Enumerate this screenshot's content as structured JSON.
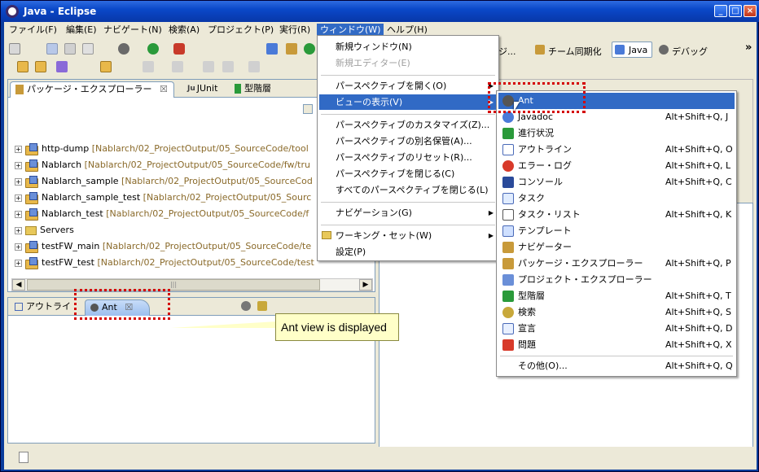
{
  "window": {
    "title": "Java - Eclipse"
  },
  "menubar": [
    {
      "label": "ファイル(F)"
    },
    {
      "label": "編集(E)"
    },
    {
      "label": "ナビゲート(N)"
    },
    {
      "label": "検索(A)"
    },
    {
      "label": "プロジェクト(P)"
    },
    {
      "label": "実行(R)"
    },
    {
      "label": "ウィンドウ(W)"
    },
    {
      "label": "ヘルプ(H)"
    }
  ],
  "perspective_bar": {
    "partial_label": "ポジ...",
    "team_sync": "チーム同期化",
    "java": "Java",
    "debug": "デバッグ",
    "overflow": "»"
  },
  "explorer": {
    "tabs": [
      "パッケージ・エクスプローラー",
      "JUnit",
      "型階層"
    ],
    "tab_close": "☒",
    "rows": [
      {
        "name": "http-dump",
        "path": "[Nablarch/02_ProjectOutput/05_SourceCode/tool"
      },
      {
        "name": "Nablarch",
        "path": "[Nablarch/02_ProjectOutput/05_SourceCode/fw/tru"
      },
      {
        "name": "Nablarch_sample",
        "path": "[Nablarch/02_ProjectOutput/05_SourceCod"
      },
      {
        "name": "Nablarch_sample_test",
        "path": "[Nablarch/02_ProjectOutput/05_Sourc"
      },
      {
        "name": "Nablarch_test",
        "path": "[Nablarch/02_ProjectOutput/05_SourceCode/f"
      },
      {
        "name": "Servers",
        "path": ""
      },
      {
        "name": "testFW_main",
        "path": "[Nablarch/02_ProjectOutput/05_SourceCode/te"
      },
      {
        "name": "testFW_test",
        "path": "[Nablarch/02_ProjectOutput/05_SourceCode/test"
      }
    ],
    "expander": "+",
    "scroll_grip": "|||"
  },
  "bottom_panel": {
    "tabs": [
      "アウトライ",
      "Ant"
    ]
  },
  "window_menu": {
    "items": [
      {
        "label": "新規ウィンドウ(N)",
        "disabled": false
      },
      {
        "label": "新規エディター(E)",
        "disabled": true
      },
      {
        "label": "パースペクティブを開く(O)",
        "submenu": true
      },
      {
        "label": "ビューの表示(V)",
        "submenu": true,
        "highlighted": true
      },
      {
        "label": "パースペクティブのカスタマイズ(Z)..."
      },
      {
        "label": "パースペクティブの別名保管(A)..."
      },
      {
        "label": "パースペクティブのリセット(R)..."
      },
      {
        "label": "パースペクティブを閉じる(C)"
      },
      {
        "label": "すべてのパースペクティブを閉じる(L)"
      },
      {
        "label": "ナビゲーション(G)",
        "submenu": true
      },
      {
        "label": "ワーキング・セット(W)",
        "submenu": true
      },
      {
        "label": "設定(P)"
      }
    ],
    "arrow": "▶"
  },
  "show_view_menu": {
    "items": [
      {
        "label": "Ant",
        "shortcut": "",
        "icon": "ant-icon",
        "highlighted": true
      },
      {
        "label": "Javadoc",
        "shortcut": "Alt+Shift+Q, J",
        "icon": "javadoc-icon"
      },
      {
        "label": "進行状況",
        "shortcut": "",
        "icon": "progress-icon"
      },
      {
        "label": "アウトライン",
        "shortcut": "Alt+Shift+Q, O",
        "icon": "outline-icon"
      },
      {
        "label": "エラー・ログ",
        "shortcut": "Alt+Shift+Q, L",
        "icon": "error-log-icon"
      },
      {
        "label": "コンソール",
        "shortcut": "Alt+Shift+Q, C",
        "icon": "console-icon"
      },
      {
        "label": "タスク",
        "shortcut": "",
        "icon": "task-icon"
      },
      {
        "label": "タスク・リスト",
        "shortcut": "Alt+Shift+Q, K",
        "icon": "task-list-icon"
      },
      {
        "label": "テンプレート",
        "shortcut": "",
        "icon": "template-icon"
      },
      {
        "label": "ナビゲーター",
        "shortcut": "",
        "icon": "navigator-icon"
      },
      {
        "label": "パッケージ・エクスプローラー",
        "shortcut": "Alt+Shift+Q, P",
        "icon": "package-explorer-icon"
      },
      {
        "label": "プロジェクト・エクスプローラー",
        "shortcut": "",
        "icon": "project-explorer-icon"
      },
      {
        "label": "型階層",
        "shortcut": "Alt+Shift+Q, T",
        "icon": "type-hierarchy-icon"
      },
      {
        "label": "検索",
        "shortcut": "Alt+Shift+Q, S",
        "icon": "search-icon"
      },
      {
        "label": "宣言",
        "shortcut": "Alt+Shift+Q, D",
        "icon": "declaration-icon"
      },
      {
        "label": "問題",
        "shortcut": "Alt+Shift+Q, X",
        "icon": "problems-icon"
      },
      {
        "label": "その他(O)...",
        "shortcut": "Alt+Shift+Q, Q",
        "icon": ""
      }
    ]
  },
  "callout": {
    "text": "Ant view is displayed"
  },
  "colors": {
    "highlight": "#316ac5",
    "annotation": "#d40000",
    "callout_bg": "#ffffc8"
  }
}
